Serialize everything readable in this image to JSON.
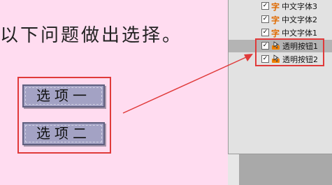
{
  "question": {
    "text": "以下问题做出选择。"
  },
  "options": [
    {
      "label": "选项一"
    },
    {
      "label": "选项二"
    }
  ],
  "layers": [
    {
      "label": "中文字体3",
      "icon": "text-icon",
      "glyph": "字",
      "checked": true,
      "selected": false
    },
    {
      "label": "中文字体2",
      "icon": "text-icon",
      "glyph": "字",
      "checked": true,
      "selected": false
    },
    {
      "label": "中文字体1",
      "icon": "text-icon",
      "glyph": "字",
      "checked": true,
      "selected": false
    },
    {
      "label": "透明按钮1",
      "icon": "button-icon",
      "checked": true,
      "selected": true
    },
    {
      "label": "透明按钮2",
      "icon": "button-icon",
      "checked": true,
      "selected": false
    }
  ],
  "checkmark": "✓",
  "colors": {
    "background": "#ffdcf0",
    "highlight": "#e03a3a",
    "button": "#a3a2c4",
    "text_icon": "#e06a00",
    "button_icon": "#f08000"
  }
}
